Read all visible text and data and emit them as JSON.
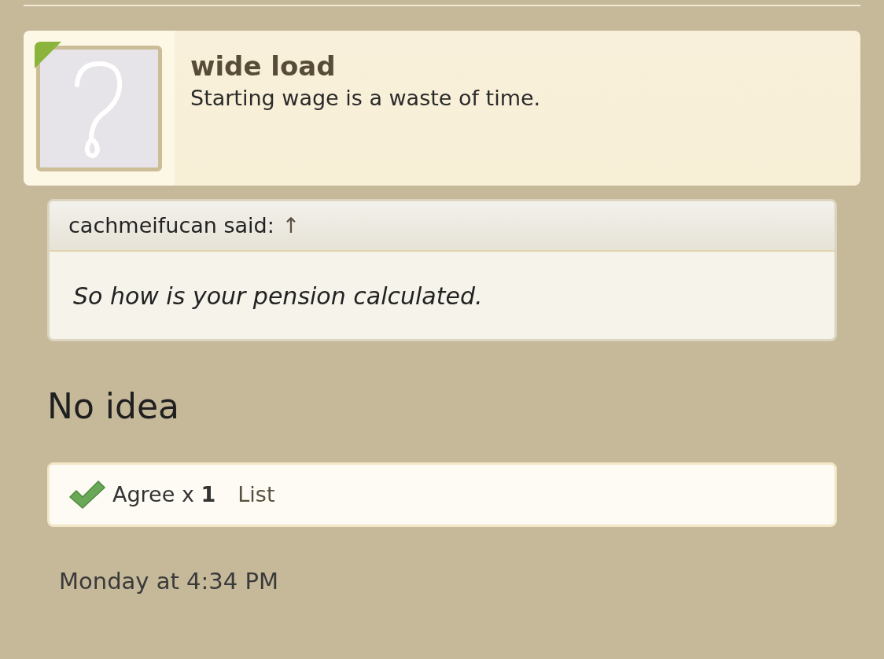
{
  "post": {
    "author": {
      "name": "wide load",
      "title": "Starting wage is a waste of time.",
      "online": true
    },
    "quote": {
      "attribution": "cachmeifucan said:",
      "link": "↑",
      "text": "So how is your pension calculated."
    },
    "message": "No idea",
    "likes": {
      "summary": "Agree x **1**",
      "list_link": "List"
    },
    "date": "Monday at 4:34 PM"
  }
}
